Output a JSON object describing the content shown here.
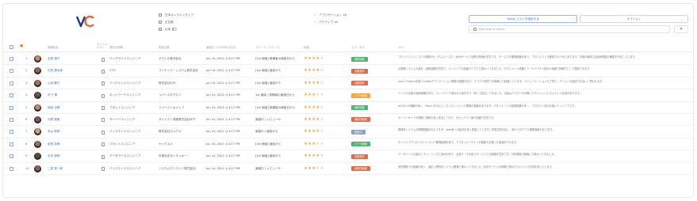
{
  "header": {
    "logo_text": "VC",
    "meta_left": [
      "日本オンラインチェア",
      "正社員",
      "山本 直之"
    ],
    "meta_right": [
      "アプリケーション 16",
      "アクティブ 16"
    ],
    "add_button": "ToDoにリストを追加する",
    "option_button": "オプション",
    "search_placeholder": "Type here to search",
    "filter_icon": "filter-icon"
  },
  "table": {
    "columns": [
      "#",
      "候補者名",
      "タイトル・マスト",
      "現在の役職",
      "所属企業",
      "面接日（2020年1月2日）",
      "ステージ（ステージ）",
      "評価",
      "ステータス",
      "メモ"
    ],
    "rows": [
      {
        "num": "1",
        "name": "吉原 達子",
        "role": "バックサイドエンジニア",
        "company": "ヤマトの株式会社",
        "date": "Jun 14, 2021 ◷ 4:17 PM",
        "status": "[1st 面接] 候補者の面接日から",
        "rating": 4,
        "badge": "最終面接",
        "badge_color": "#4fb26d",
        "memo": "フロントエンジニアとの連携がとてもスムーズで、Webサービス全般の知識が豊富です。チームでの開発経験があり、プロジェクトの推進力も十分にあります。次回の面接では技術課題の確認を予定しています。",
        "avatar": "#c58c6a"
      },
      {
        "num": "2",
        "name": "石田 健太郎",
        "role": "CTO",
        "company": "フジテック・システム株式会社",
        "date": "Jun 14, 2021 ◷ 4:17 PM",
        "status": "[1st 面接] 面談から",
        "rating": 4,
        "badge": "書類選考",
        "badge_color": "#e0694a",
        "memo": "大規模システムの設計・運用経験が豊富で、エンジニアの組織づくりにも携わってきました。マネジメント経験とアーキテクチャ設計の両面で即戦力として期待できます。",
        "avatar": "#8e6a54"
      },
      {
        "num": "3",
        "name": "山本 龍平",
        "role": "バックエンドエンジニア",
        "company": "株式会社NTS",
        "date": "Jun 14, 2021 ◷ 4:17 PM",
        "status": "[1st 面接] 面談から",
        "rating": 4,
        "badge": "書類選考",
        "badge_color": "#e0694a",
        "memo": "Java とPythonを使ったWebアプリケーション開発の経験があり、クラウド環境での構築にも精通しています。コミュニケーションも丁寧で、チームへの適応力も高いと思われます。",
        "avatar": "#a47157"
      },
      {
        "num": "4",
        "name": "市下 潤",
        "role": "ネットワークエンジニア",
        "company": "リバースネクスト",
        "date": "Jun 14, 2021 ◷ 4:17 PM",
        "status": "1st 面接 | 候補者の面接日から",
        "rating": 3,
        "badge": "ビデオ面接",
        "badge_color": "#f2a43a",
        "memo": "インフラ全般の運用経験を持ち、ネットワーク設計から保守まで一貫して担当してきました。今後はクラウドの分野にもチャレンジしたいという意欲があります。",
        "avatar": "#6a5446"
      },
      {
        "num": "5",
        "name": "岡田 法晴",
        "role": "フロントエンジニア",
        "company": "ファーストキャップ",
        "date": "Jun 14, 2021 ◷ 4:17 PM",
        "status": "[1st 面接] 候補者の面接日から",
        "rating": 4,
        "badge": "最終面接",
        "badge_color": "#4fb26d",
        "memo": "UI/UXへの理解が深く、React を中心としたフロントエンド開発の実績があります。デザイナーとの協業経験も多く、プロダクト志向の強いエンジニアです。",
        "avatar": "#b98a70"
      },
      {
        "num": "6",
        "name": "今野 恵美",
        "role": "サーバーエンジニア",
        "company": "ダイレクト資産株式会社NTT",
        "date": "Jun 14, 2021 ◷ 4:17 PM",
        "status": "面接中 | レビューサ",
        "rating": 4,
        "badge": "最終的面接",
        "badge_color": "#e0694a",
        "memo": "サーバーサイドの開発と運用を長く担当しており、セキュリティ面の知識も豊富です。",
        "avatar": "#7b5a4a"
      },
      {
        "num": "7",
        "name": "赤山 和男",
        "role": "バックエンドエンジニア",
        "company": "株式会社カルクル",
        "date": "Jun 14, 2021 ◷ 4:17 PM",
        "status": "面接中 | 面談から",
        "rating": 4,
        "badge": "見送り",
        "badge_color": "#8ea3c9",
        "memo": "業務系システムの開発経験が中心ですが、Web系への転向を強く希望しています。学習意欲が高く、個人でのアプリ開発実績もあります。",
        "avatar": "#c9a27e"
      },
      {
        "num": "8",
        "name": "宮田 奈美",
        "role": "フロントエンジニア",
        "company": "ケックス人",
        "date": "Jun 14, 2021 ◷ 4:17 PM",
        "status": "[1st 面接] 面談から",
        "rating": 3,
        "badge": "ビデオ面接",
        "badge_color": "#4fb26d",
        "memo": "モバイルアプリのフロントエンド開発経験があり、アクセシビリティへの配慮も意識した実装ができます。",
        "avatar": "#9c6f58"
      },
      {
        "num": "9",
        "name": "吉本 秀明",
        "role": "データベースエンジニア",
        "company": "外部空合ポンサンキー",
        "date": "Jun 14, 2021 ◷ 4:17 PM",
        "status": "[1st 面接] 面談から",
        "rating": 4,
        "badge": "書類選考",
        "badge_color": "#e0694a",
        "memo": "データベースの設計とチューニングに強みがあり、大量データを扱うサービスでの経験が豊富です。分析基盤の構築にも携わってきました。",
        "avatar": "#5e4638"
      },
      {
        "num": "10",
        "name": "二宮 秀一郎",
        "role": "バックエンドエンジニア",
        "company": "システムクリエイト株式会社",
        "date": "Jun 14, 2021 ◷ 4:17 PM",
        "status": "面接中 | レビューサ",
        "rating": 3,
        "badge": "最終的面接",
        "badge_color": "#e0694a",
        "memo": "受託開発での経験が長く、幅広い業界のシステム開発に携わってきました。自社サービスの開発に関わりたいという志向を持っています。",
        "avatar": "#8a6250"
      }
    ]
  }
}
